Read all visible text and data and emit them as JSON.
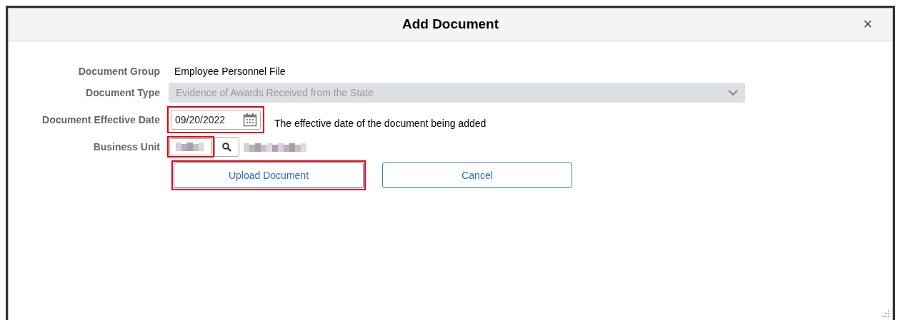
{
  "dialog": {
    "title": "Add Document",
    "close": "×"
  },
  "fields": [
    {
      "kind": "text",
      "label": "Document Group",
      "value": "Employee Personnel File"
    },
    {
      "kind": "select",
      "label": "Document Type",
      "value": "Evidence of Awards Received from the State",
      "disabled": true
    },
    {
      "kind": "date",
      "label": "Document Effective Date",
      "value": "09/20/2022",
      "hint": "The effective date of the document being added",
      "highlighted": true
    },
    {
      "kind": "lookup",
      "label": "Business Unit",
      "highlighted": true
    }
  ],
  "buttons": [
    {
      "label": "Upload Document",
      "highlighted": true
    },
    {
      "label": "Cancel",
      "highlighted": false
    }
  ]
}
